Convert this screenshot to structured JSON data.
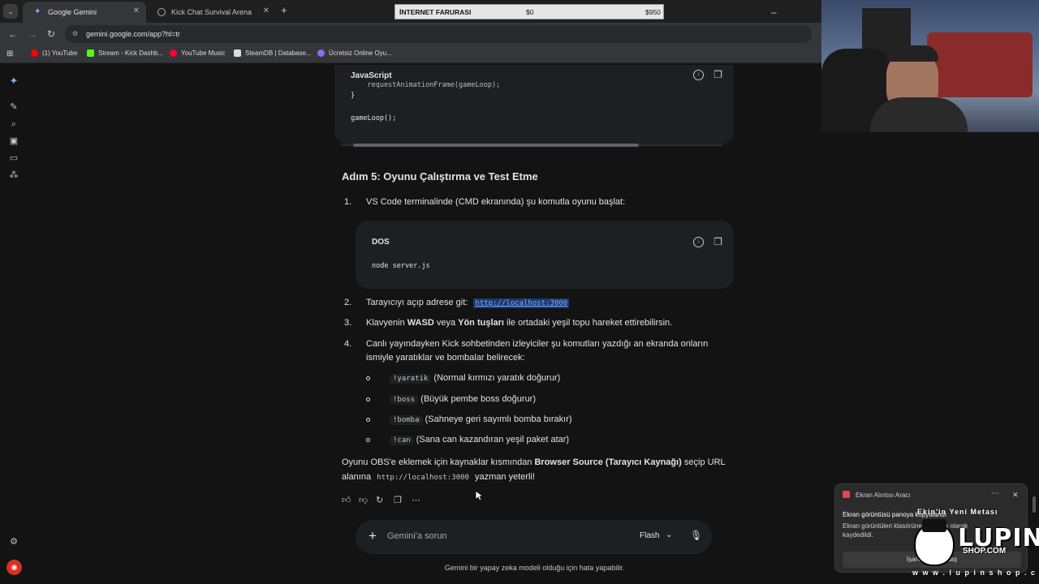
{
  "tabs": [
    {
      "title": "Google Gemini",
      "active": true
    },
    {
      "title": "Kick Chat Survival Arena",
      "active": false
    }
  ],
  "overlay_bar": {
    "label": "İNTERNET FARURASI",
    "value1": "$0",
    "value2": "$950"
  },
  "address": {
    "url": "gemini.google.com/app?hl=tr"
  },
  "bookmarks": [
    {
      "label": "(1) YouTube",
      "color": "#ff0000"
    },
    {
      "label": "Stream - Kick Dashb...",
      "color": "#53fc18"
    },
    {
      "label": "YouTube Music",
      "color": "#ff0033"
    },
    {
      "label": "SteamDB | Database...",
      "color": "#ffffff"
    },
    {
      "label": "Ücretsiz Online Oyu...",
      "color": "#8e6cf0"
    }
  ],
  "code_block_1": {
    "language": "JavaScript",
    "lines": [
      "    requestAnimationFrame(gameLoop);",
      "}",
      "",
      "gameLoop();"
    ]
  },
  "step5": {
    "heading": "Adım 5: Oyunu Çalıştırma ve Test Etme",
    "items": [
      {
        "num": "1.",
        "text": "VS Code terminalinde (CMD ekranında) şu komutla oyunu başlat:"
      },
      {
        "num": "2.",
        "text": "Tarayıcıyı açıp adrese git:",
        "link": "http://localhost:3000"
      },
      {
        "num": "3.",
        "pre": "Klavyenin ",
        "b1": "WASD",
        "mid": " veya ",
        "b2": "Yön tuşları",
        "post": " ile ortadaki yeşil topu hareket ettirebilirsin."
      },
      {
        "num": "4.",
        "line1": "Canlı yayındayken Kick sohbetinden izleyiciler şu komutları yazdığı an ekranda onların",
        "line2": "ismiyle yaratıklar ve bombalar belirecek:"
      }
    ],
    "commands": [
      {
        "cmd": "!yaratik",
        "desc": "(Normal kırmızı yaratık doğurur)"
      },
      {
        "cmd": "!boss",
        "desc": "(Büyük pembe boss doğurur)"
      },
      {
        "cmd": "!bomba",
        "desc": "(Sahneye geri sayımlı bomba bırakır)"
      },
      {
        "cmd": "!can",
        "desc": "(Sana can kazandıran yeşil paket atar)"
      }
    ]
  },
  "code_block_2": {
    "language": "DOS",
    "lines": [
      "node server.js"
    ]
  },
  "obs_note": {
    "pre": "Oyunu OBS'e eklemek için kaynaklar kısmından ",
    "bold": "Browser Source (Tarayıcı Kaynağı)",
    "post": " seçip URL",
    "line2_pre": "alanına ",
    "code": "http://localhost:3000",
    "line2_post": " yazman yeterli!"
  },
  "input": {
    "placeholder": "Gemini'a sorun",
    "model": "Flash"
  },
  "footer": "Gemini bir yapay zeka modeli olduğu için hata yapabilir.",
  "notification": {
    "app": "Ekran Alıntısı Aracı",
    "line1": "Ekran görüntüsü panoya kopyalandı",
    "line2": "Ekran görüntüleri klasörüne otomatik olarak",
    "line3": "kaydedildi.",
    "button": "İşaretle ve paylaş"
  },
  "lupin": {
    "title": "Ekin'in Yeni Metası",
    "brand": "LUPIN",
    "shop": "SHOP.COM",
    "url": "w w w . l u p i n s h o p . c o m"
  },
  "colors": {
    "background": "#131314",
    "surface": "#1e1f20",
    "accent": "#7cacf8"
  }
}
